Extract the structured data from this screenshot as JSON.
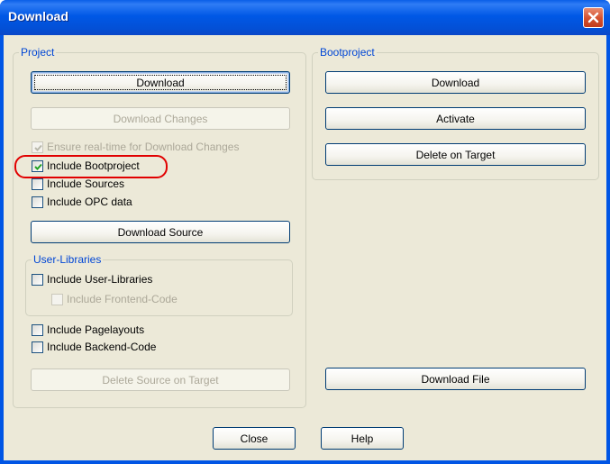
{
  "window": {
    "title": "Download"
  },
  "project": {
    "label": "Project",
    "download_label": "Download",
    "download_changes_label": "Download Changes",
    "ensure_realtime_label": "Ensure real-time for Download Changes",
    "include_bootproject_label": "Include Bootproject",
    "include_sources_label": "Include Sources",
    "include_opc_label": "Include OPC data",
    "download_source_label": "Download Source",
    "include_pagelayouts_label": "Include Pagelayouts",
    "include_backend_label": "Include Backend-Code",
    "delete_source_label": "Delete Source on Target",
    "checked": {
      "ensure_realtime": true,
      "include_bootproject": true,
      "include_sources": false,
      "include_opc": false,
      "include_pagelayouts": false,
      "include_backend": false
    }
  },
  "user_libraries": {
    "label": "User-Libraries",
    "include_user_libraries_label": "Include User-Libraries",
    "include_frontend_label": "Include Frontend-Code"
  },
  "bootproject": {
    "label": "Bootproject",
    "download_label": "Download",
    "activate_label": "Activate",
    "delete_on_target_label": "Delete on Target",
    "download_file_label": "Download File"
  },
  "footer": {
    "close_label": "Close",
    "help_label": "Help"
  },
  "colors": {
    "title_bar": "#0058e6",
    "dialog_bg": "#ece9d8",
    "group_label": "#0046d5",
    "highlight": "#e10000"
  },
  "icons": {
    "close": "close-x-icon",
    "check": "checkmark-icon"
  }
}
